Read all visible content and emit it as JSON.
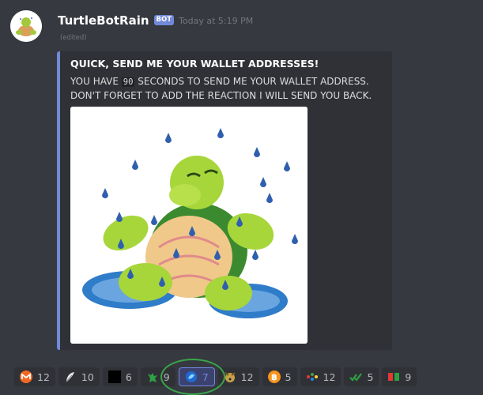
{
  "message": {
    "author": "TurtleBotRain",
    "bot_tag": "BOT",
    "timestamp": "Today at 5:19 PM",
    "edited": "(edited)"
  },
  "embed": {
    "title": "QUICK, SEND ME YOUR WALLET ADDRESSES!",
    "desc_line1_prefix": "YOU HAVE ",
    "desc_code": "90",
    "desc_line1_suffix": " SECONDS TO SEND ME YOUR WALLET ADDRESS.",
    "desc_line2": "DON'T FORGET TO ADD THE REACTION I WILL SEND YOU BACK.",
    "accent_color": "#7289da"
  },
  "reactions": [
    {
      "icon": "monero-icon",
      "count": "12"
    },
    {
      "icon": "feather-icon",
      "count": "10"
    },
    {
      "icon": "black-square-icon",
      "count": "6"
    },
    {
      "icon": "green-creature-icon",
      "count": "9"
    },
    {
      "icon": "blue-coin-icon",
      "count": "7",
      "selected": true
    },
    {
      "icon": "dog-icon",
      "count": "12"
    },
    {
      "icon": "bitcoin-icon",
      "count": "5"
    },
    {
      "icon": "colored-dots-icon",
      "count": "12"
    },
    {
      "icon": "green-check-icon",
      "count": "5"
    },
    {
      "icon": "red-green-icon",
      "count": "9"
    }
  ]
}
